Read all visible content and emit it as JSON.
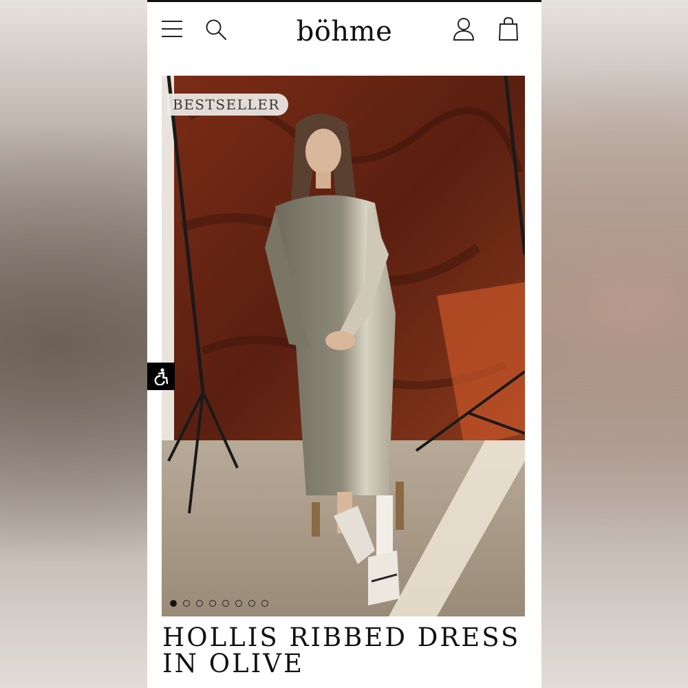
{
  "brand": {
    "logo_text": "böhme"
  },
  "header": {
    "icons": [
      "menu-icon",
      "search-icon",
      "account-icon",
      "bag-icon"
    ]
  },
  "product": {
    "badge": "BESTSELLER",
    "title_line1": "HOLLIS RIBBED DRESS",
    "title_line2": "IN OLIVE",
    "carousel": {
      "total": 8,
      "active_index": 0
    }
  },
  "accessibility": {
    "icon": "accessibility-icon"
  },
  "colors": {
    "text": "#111111",
    "backdrop": "#6b2a18",
    "dress": "#8e8a7a"
  }
}
